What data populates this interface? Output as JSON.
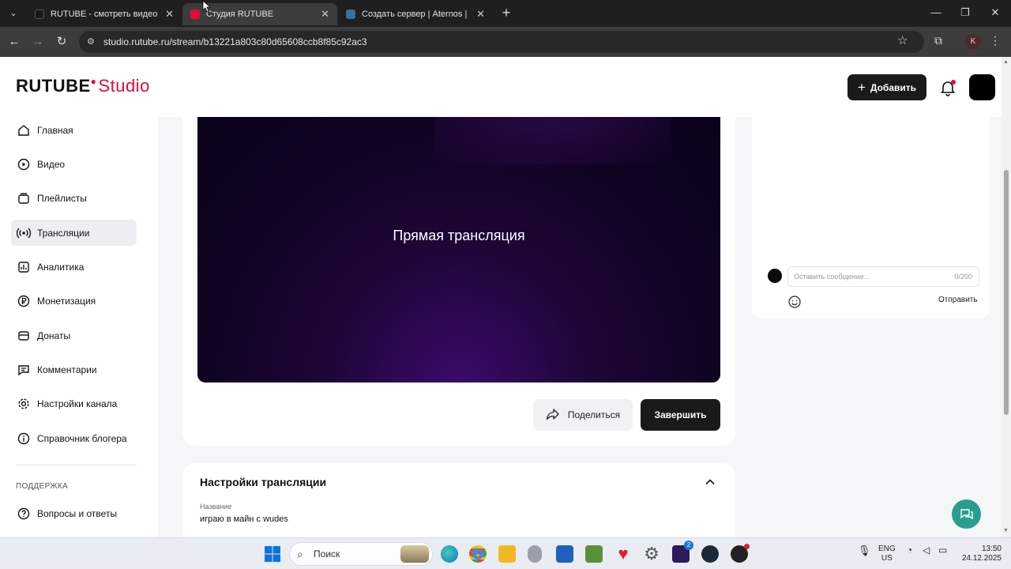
{
  "browser": {
    "tabs": [
      {
        "title": "RUTUBE - смотреть видео онл",
        "favicon_color": "#1a1a1a",
        "active": false
      },
      {
        "title": "Студия RUTUBE",
        "favicon_color": "#e30b3a",
        "active": true
      },
      {
        "title": "Создать сервер | Aternos | Бес",
        "favicon_color": "#3a6ea5",
        "active": false
      }
    ],
    "url": "studio.rutube.ru/stream/b13221a803c80d65608ccb8f85c92ac3",
    "profile_initial": "K"
  },
  "header": {
    "logo_main": "RUTUBE",
    "logo_studio": "Studio",
    "add_label": "Добавить"
  },
  "sidebar": {
    "items": [
      {
        "label": "Главная",
        "icon": "home-icon"
      },
      {
        "label": "Видео",
        "icon": "video-icon"
      },
      {
        "label": "Плейлисты",
        "icon": "playlist-icon"
      },
      {
        "label": "Трансляции",
        "icon": "broadcast-icon",
        "active": true
      },
      {
        "label": "Аналитика",
        "icon": "analytics-icon"
      },
      {
        "label": "Монетизация",
        "icon": "ruble-icon"
      },
      {
        "label": "Донаты",
        "icon": "donate-icon"
      },
      {
        "label": "Комментарии",
        "icon": "comments-icon"
      },
      {
        "label": "Настройки канала",
        "icon": "gear-icon"
      },
      {
        "label": "Справочник блогера",
        "icon": "info-icon"
      }
    ],
    "support_label": "ПОДДЕРЖКА",
    "support_items": [
      {
        "label": "Вопросы и ответы",
        "icon": "question-icon"
      }
    ]
  },
  "player": {
    "caption": "Прямая трансляция",
    "share_label": "Поделиться",
    "end_label": "Завершить"
  },
  "chat": {
    "placeholder": "Оставить сообщение...",
    "counter": "0/200",
    "send_label": "Отправить"
  },
  "settings": {
    "title": "Настройки трансляции",
    "name_label": "Название",
    "name_value": "играю в майн с wudes"
  },
  "taskbar": {
    "search_label": "Поиск",
    "lang_top": "ENG",
    "lang_bottom": "US",
    "time": "13:50",
    "date": "24.12.2025",
    "steam_badge": "2"
  }
}
